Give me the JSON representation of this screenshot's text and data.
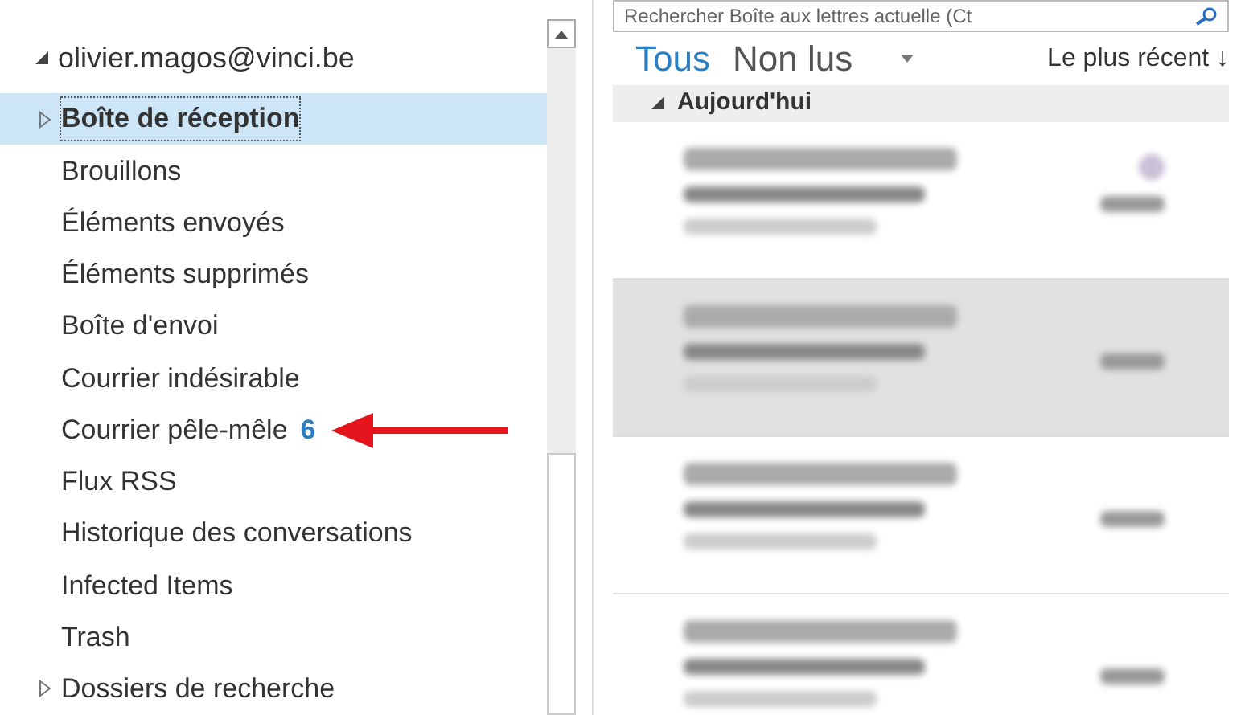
{
  "account": {
    "name": "olivier.magos@vinci.be",
    "expanded": true,
    "folders": [
      {
        "name": "Boîte de réception",
        "selected": true,
        "expandable": true,
        "pointer": false
      },
      {
        "name": "Brouillons",
        "selected": false,
        "expandable": false,
        "pointer": false
      },
      {
        "name": "Éléments envoyés",
        "selected": false,
        "expandable": false,
        "pointer": false
      },
      {
        "name": "Éléments supprimés",
        "selected": false,
        "expandable": false,
        "pointer": false
      },
      {
        "name": "Boîte d'envoi",
        "selected": false,
        "expandable": false,
        "pointer": false
      },
      {
        "name": "Courrier indésirable",
        "selected": false,
        "expandable": false,
        "pointer": false
      },
      {
        "name": "Courrier pêle-mêle",
        "count": "6",
        "selected": false,
        "expandable": false,
        "pointer": true
      },
      {
        "name": "Flux RSS",
        "selected": false,
        "expandable": false,
        "pointer": false
      },
      {
        "name": "Historique des conversations",
        "selected": false,
        "expandable": false,
        "pointer": false
      },
      {
        "name": "Infected Items",
        "selected": false,
        "expandable": false,
        "pointer": false
      },
      {
        "name": "Trash",
        "selected": false,
        "expandable": false,
        "pointer": false
      },
      {
        "name": "Dossiers de recherche",
        "selected": false,
        "expandable": true,
        "pointer": false
      }
    ]
  },
  "search": {
    "placeholder": "Rechercher Boîte aux lettres actuelle (Ct"
  },
  "filters": [
    {
      "label": "Tous",
      "selected": true
    },
    {
      "label": "Non lus",
      "selected": false
    }
  ],
  "sort": {
    "label": "Le plus récent ↓"
  },
  "group": {
    "label": "Aujourd'hui",
    "expanded": true
  },
  "messages": [
    {
      "selected": false,
      "icon": true
    },
    {
      "selected": true,
      "icon": false
    },
    {
      "selected": false,
      "icon": false
    },
    {
      "selected": false,
      "icon": false
    }
  ]
}
